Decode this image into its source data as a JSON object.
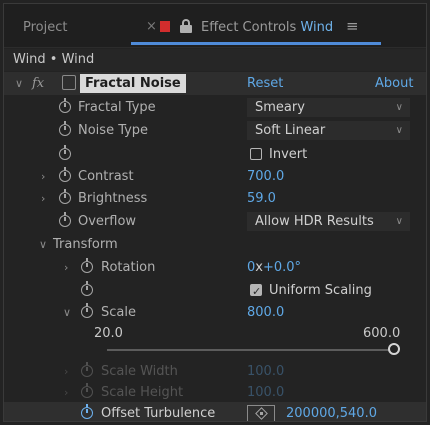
{
  "tabs": {
    "project_label": "Project",
    "close_glyph": "×",
    "effect_controls_prefix": "Effect Controls",
    "effect_controls_layer": "Wind",
    "menu_glyph": "≡"
  },
  "breadcrumb": "Wind • Wind",
  "effect": {
    "fx_label": "fx",
    "name": "Fractal Noise",
    "reset_label": "Reset",
    "about_label": "About"
  },
  "properties": {
    "fractal_type": {
      "label": "Fractal Type",
      "value": "Smeary"
    },
    "noise_type": {
      "label": "Noise Type",
      "value": "Soft Linear"
    },
    "invert": {
      "label": "Invert",
      "checked": false
    },
    "contrast": {
      "label": "Contrast",
      "value": "700.0"
    },
    "brightness": {
      "label": "Brightness",
      "value": "59.0"
    },
    "overflow": {
      "label": "Overflow",
      "value": "Allow HDR Results"
    },
    "transform_label": "Transform",
    "rotation": {
      "label": "Rotation",
      "value_turns": "0",
      "value_x": "x",
      "value_deg": "+0.0°"
    },
    "uniform_scaling": {
      "label": "Uniform Scaling",
      "checked": true
    },
    "scale": {
      "label": "Scale",
      "value": "800.0",
      "slider_min": "20.0",
      "slider_max": "600.0",
      "slider_level": 1.0
    },
    "scale_width": {
      "label": "Scale Width",
      "value": "100.0"
    },
    "scale_height": {
      "label": "Scale Height",
      "value": "100.0"
    },
    "offset_turbulence": {
      "label": "Offset Turbulence",
      "value": "200000,540.0"
    }
  },
  "colors": {
    "accent_blue": "#5fa8e6",
    "tab_underline": "#4f8bd8",
    "close_red": "#d22d2d"
  }
}
